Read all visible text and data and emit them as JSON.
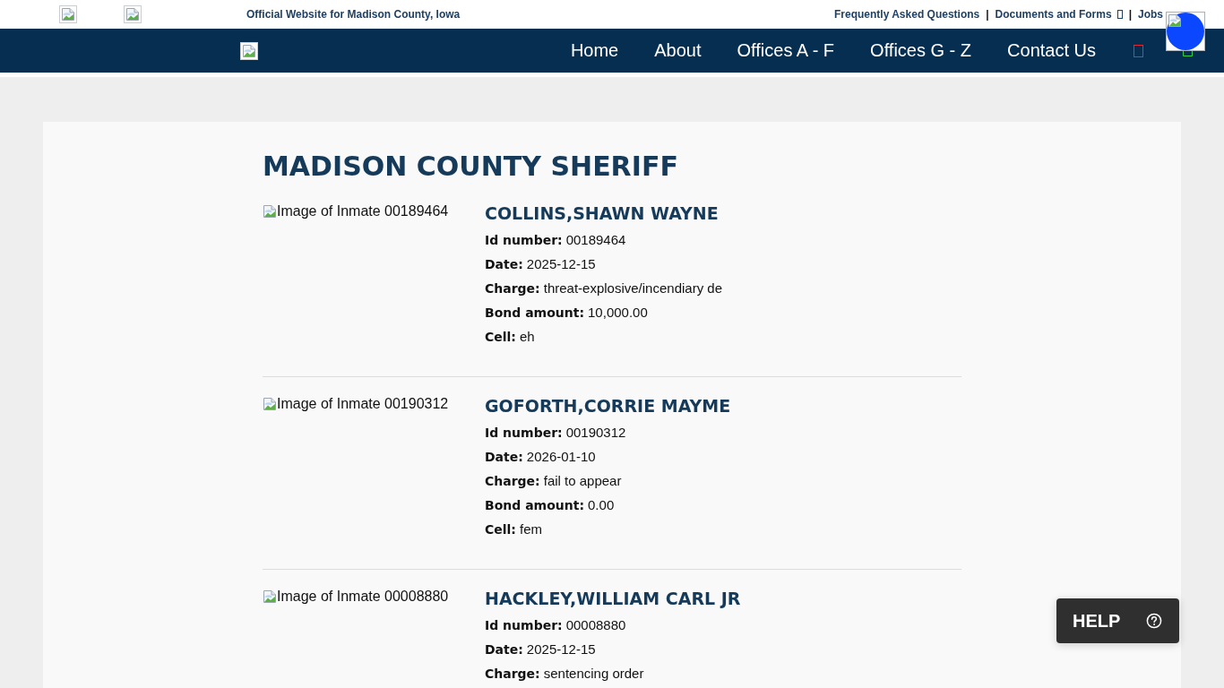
{
  "top_bar": {
    "tagline": "Official Website for Madison County, Iowa",
    "links": [
      {
        "label": "Frequently Asked Questions",
        "has_icon": false
      },
      {
        "label": "Documents and Forms",
        "has_icon": true
      },
      {
        "label": "Jobs",
        "has_icon": false
      }
    ],
    "separators": [
      "|",
      "|"
    ]
  },
  "nav": {
    "items": [
      {
        "label": "Home"
      },
      {
        "label": "About"
      },
      {
        "label": "Offices A - F"
      },
      {
        "label": "Offices G - Z"
      },
      {
        "label": "Contact Us"
      }
    ],
    "icons": [
      {
        "color": "#e8282e"
      },
      {
        "color": "#2fd24a"
      }
    ]
  },
  "page": {
    "title": "MADISON COUNTY SHERIFF",
    "inmates": [
      {
        "image_alt": "Image of Inmate 00189464",
        "name": "COLLINS,SHAWN WAYNE",
        "fields": [
          {
            "label": "Id number:",
            "value": "00189464"
          },
          {
            "label": "Date:",
            "value": "2025-12-15"
          },
          {
            "label": "Charge:",
            "value": "threat-explosive/incendiary de"
          },
          {
            "label": "Bond amount:",
            "value": "10,000.00"
          },
          {
            "label": "Cell:",
            "value": "eh"
          }
        ]
      },
      {
        "image_alt": "Image of Inmate 00190312",
        "name": "GOFORTH,CORRIE MAYME",
        "fields": [
          {
            "label": "Id number:",
            "value": "00190312"
          },
          {
            "label": "Date:",
            "value": "2026-01-10"
          },
          {
            "label": "Charge:",
            "value": "fail to appear"
          },
          {
            "label": "Bond amount:",
            "value": "0.00"
          },
          {
            "label": "Cell:",
            "value": "fem"
          }
        ]
      },
      {
        "image_alt": "Image of Inmate 00008880",
        "name": "HACKLEY,WILLIAM CARL JR",
        "fields": [
          {
            "label": "Id number:",
            "value": "00008880"
          },
          {
            "label": "Date:",
            "value": "2025-12-15"
          },
          {
            "label": "Charge:",
            "value": "sentencing order"
          }
        ]
      }
    ]
  },
  "help_button": {
    "label": "HELP"
  }
}
